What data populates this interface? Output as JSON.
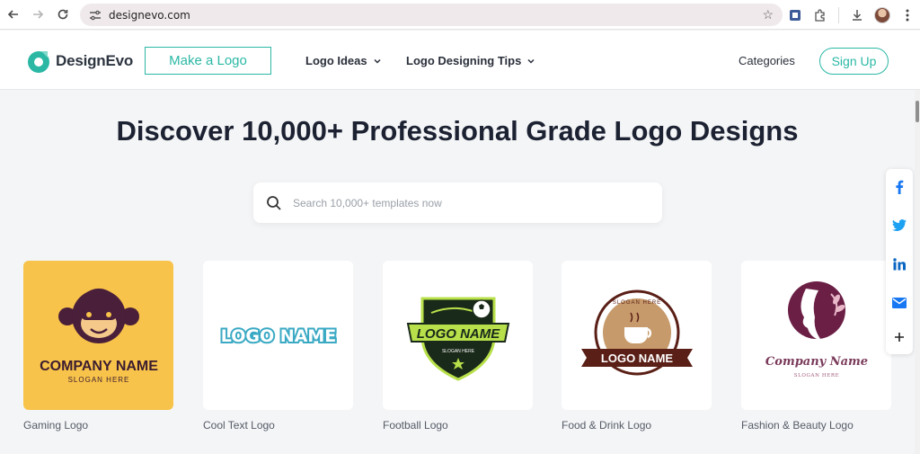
{
  "browser": {
    "url": "designevo.com"
  },
  "header": {
    "brand": "DesignEvo",
    "make_logo": "Make a Logo",
    "logo_ideas": "Logo Ideas",
    "logo_tips": "Logo Designing Tips",
    "categories": "Categories",
    "sign_up": "Sign Up"
  },
  "hero": {
    "title": "Discover 10,000+ Professional Grade Logo Designs",
    "search_placeholder": "Search 10,000+ templates now"
  },
  "share": [
    "facebook-icon",
    "twitter-icon",
    "linkedin-icon",
    "mail-icon",
    "plus-icon"
  ],
  "colors": {
    "accent": "#2ab8a5",
    "gaming_bg": "#f8c34a"
  },
  "cards": [
    {
      "label": "Gaming Logo",
      "logo_name": "COMPANY NAME",
      "slogan": "SLOGAN HERE"
    },
    {
      "label": "Cool Text Logo",
      "logo_name": "LOGO NAME"
    },
    {
      "label": "Football Logo",
      "logo_name": "LOGO NAME",
      "slogan": "SLOGAN HERE"
    },
    {
      "label": "Food & Drink Logo",
      "logo_name": "LOGO NAME",
      "slogan": "SLOGAN HERE"
    },
    {
      "label": "Fashion & Beauty Logo",
      "logo_name": "Company Name",
      "slogan": "SLOGAN HERE"
    }
  ]
}
